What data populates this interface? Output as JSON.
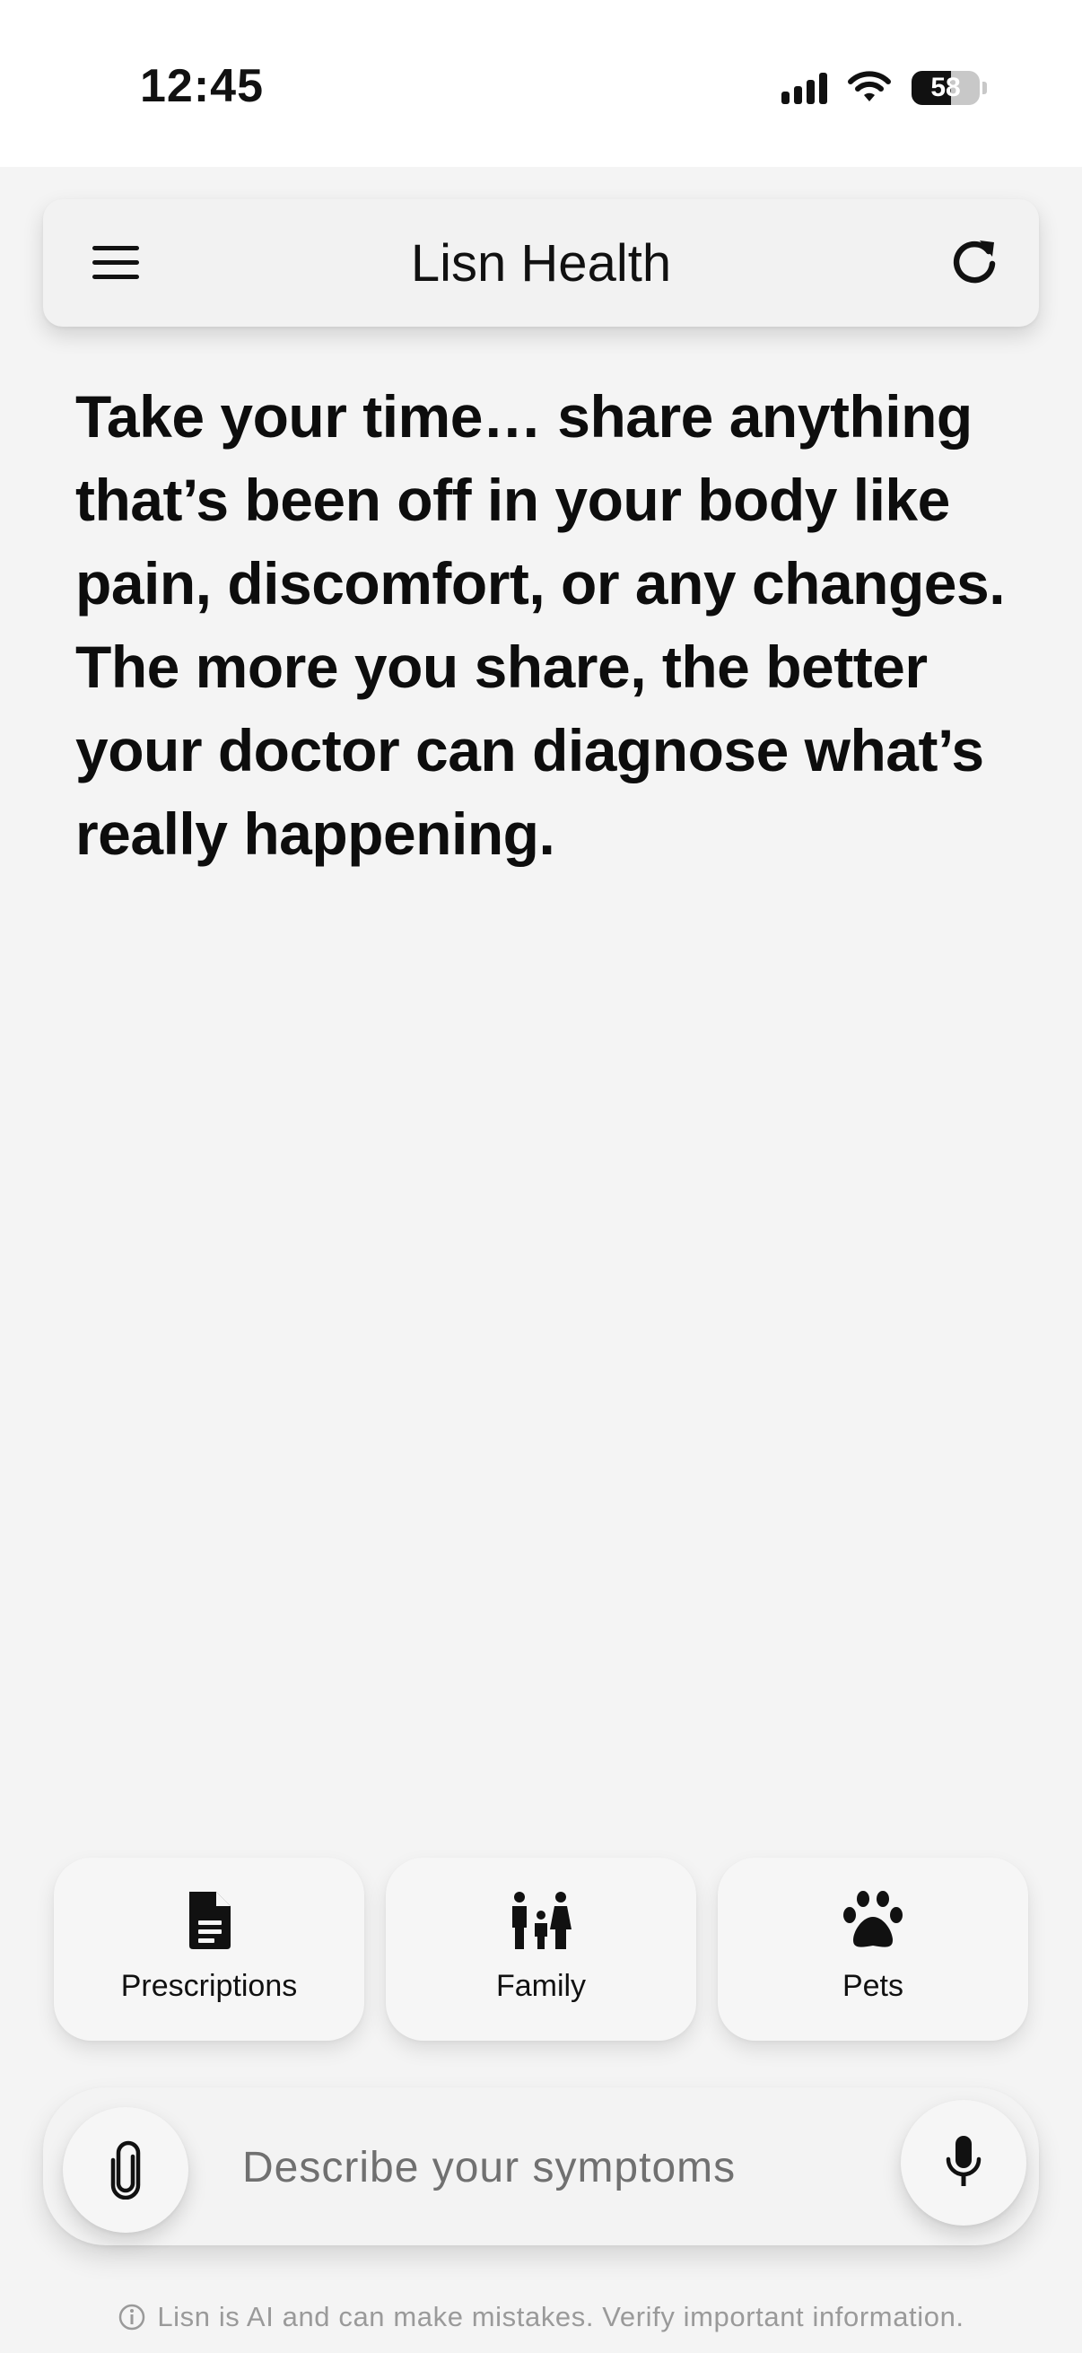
{
  "status_bar": {
    "time": "12:45",
    "battery_level": "58",
    "signal_icon": "signal-bars-icon",
    "wifi_icon": "wifi-icon"
  },
  "header": {
    "title": "Lisn Health",
    "menu_icon": "hamburger-menu-icon",
    "refresh_icon": "refresh-icon"
  },
  "prompt": {
    "text": "Take your time… share anything that’s been off in your body like pain, discomfort, or any changes. The more you share, the better your doctor can diagnose what’s really happening."
  },
  "quick_actions": [
    {
      "label": "Prescriptions",
      "icon": "document-icon"
    },
    {
      "label": "Family",
      "icon": "family-icon"
    },
    {
      "label": "Pets",
      "icon": "paw-icon"
    }
  ],
  "input": {
    "placeholder": "Describe your symptoms",
    "value": "",
    "attach_icon": "paperclip-icon",
    "mic_icon": "microphone-icon"
  },
  "disclaimer": {
    "text": "Lisn is AI and can make mistakes. Verify important information.",
    "icon": "info-icon"
  },
  "colors": {
    "background": "#f4f4f4",
    "text": "#111111",
    "muted": "#9a9a9a",
    "placeholder": "#707070"
  }
}
